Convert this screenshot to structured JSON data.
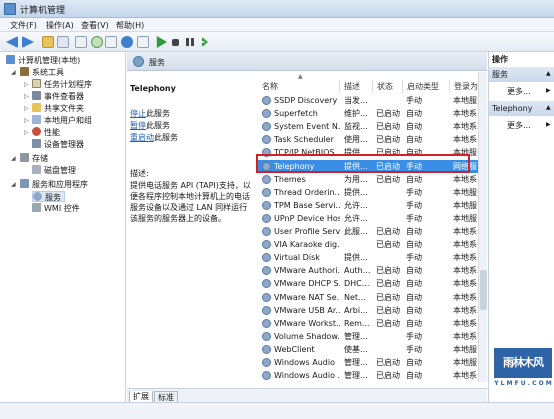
{
  "window": {
    "title": "计算机管理"
  },
  "menu": [
    "文件(F)",
    "操作(A)",
    "查看(V)",
    "帮助(H)"
  ],
  "tree": {
    "root": "计算机管理(本地)",
    "system_tools": "系统工具",
    "task_scheduler": "任务计划程序",
    "event_viewer": "事件查看器",
    "shared_folders": "共享文件夹",
    "local_users": "本地用户和组",
    "performance": "性能",
    "device_manager": "设备管理器",
    "storage": "存储",
    "disk_management": "磁盘管理",
    "services_apps": "服务和应用程序",
    "services": "服务",
    "wmi": "WMI 控件"
  },
  "header": {
    "label": "服务"
  },
  "description": {
    "service_name": "Telephony",
    "stop_link": "停止",
    "stop_suffix": "此服务",
    "pause_link": "暂停",
    "pause_suffix": "此服务",
    "restart_link": "重启动",
    "restart_suffix": "此服务",
    "desc_label": "描述:",
    "desc_text": "提供电话服务 API (TAPI)支持，以便各程序控制本地计算机上的电话服务设备以及通过 LAN 同样运行该服务的服务器上的设备。"
  },
  "columns": [
    "名称",
    "描述",
    "状态",
    "启动类型",
    "登录为"
  ],
  "rows": [
    {
      "name": "SSDP Discovery",
      "desc": "当发...",
      "status": "",
      "startup": "手动",
      "logon": "本地服"
    },
    {
      "name": "Superfetch",
      "desc": "维护...",
      "status": "已启动",
      "startup": "自动",
      "logon": "本地系"
    },
    {
      "name": "System Event N...",
      "desc": "监视...",
      "status": "已启动",
      "startup": "自动",
      "logon": "本地系"
    },
    {
      "name": "Task Scheduler",
      "desc": "使用...",
      "status": "已启动",
      "startup": "自动",
      "logon": "本地系"
    },
    {
      "name": "TCP/IP NetBIOS ...",
      "desc": "提供...",
      "status": "已启动",
      "startup": "自动",
      "logon": "本地服"
    },
    {
      "name": "Telephony",
      "desc": "提供...",
      "status": "已启动",
      "startup": "手动",
      "logon": "网络服"
    },
    {
      "name": "Themes",
      "desc": "为用...",
      "status": "已启动",
      "startup": "自动",
      "logon": "本地系"
    },
    {
      "name": "Thread Orderin...",
      "desc": "提供...",
      "status": "",
      "startup": "手动",
      "logon": "本地服"
    },
    {
      "name": "TPM Base Servi...",
      "desc": "允许...",
      "status": "",
      "startup": "手动",
      "logon": "本地服"
    },
    {
      "name": "UPnP Device Host",
      "desc": "允许...",
      "status": "",
      "startup": "手动",
      "logon": "本地服"
    },
    {
      "name": "User Profile Serv...",
      "desc": "此服...",
      "status": "已启动",
      "startup": "自动",
      "logon": "本地系"
    },
    {
      "name": "VIA Karaoke dig...",
      "desc": "",
      "status": "已启动",
      "startup": "自动",
      "logon": "本地系"
    },
    {
      "name": "Virtual Disk",
      "desc": "提供...",
      "status": "",
      "startup": "手动",
      "logon": "本地系"
    },
    {
      "name": "VMware Authori...",
      "desc": "Auth...",
      "status": "已启动",
      "startup": "自动",
      "logon": "本地系"
    },
    {
      "name": "VMware DHCP S...",
      "desc": "DHC...",
      "status": "已启动",
      "startup": "自动",
      "logon": "本地系"
    },
    {
      "name": "VMware NAT Se...",
      "desc": "Net...",
      "status": "已启动",
      "startup": "自动",
      "logon": "本地系"
    },
    {
      "name": "VMware USB Ar...",
      "desc": "Arbi...",
      "status": "已启动",
      "startup": "自动",
      "logon": "本地系"
    },
    {
      "name": "VMware Workst...",
      "desc": "Rem...",
      "status": "已启动",
      "startup": "自动",
      "logon": "本地系"
    },
    {
      "name": "Volume Shadow...",
      "desc": "管理...",
      "status": "",
      "startup": "手动",
      "logon": "本地系"
    },
    {
      "name": "WebClient",
      "desc": "使基...",
      "status": "",
      "startup": "手动",
      "logon": "本地服"
    },
    {
      "name": "Windows Audio",
      "desc": "管理...",
      "status": "已启动",
      "startup": "自动",
      "logon": "本地服"
    },
    {
      "name": "Windows Audio ...",
      "desc": "管理...",
      "status": "已启动",
      "startup": "自动",
      "logon": "本地系"
    }
  ],
  "actions": {
    "title": "操作",
    "group1": "服务",
    "more1": "更多...",
    "group2": "Telephony",
    "more2": "更多..."
  },
  "tabs": [
    "扩展",
    "标准"
  ],
  "watermark": {
    "brand": "雨林木风",
    "url": "Y L M F U . C O M"
  },
  "colors": {
    "selection": "#3a8ee6",
    "highlight_box": "#d0202a",
    "link": "#1f5fb8"
  }
}
